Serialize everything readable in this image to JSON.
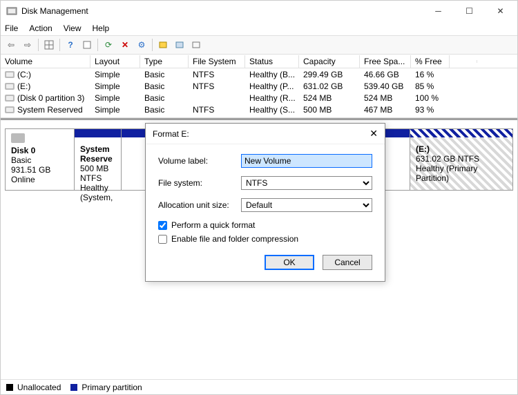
{
  "window": {
    "title": "Disk Management"
  },
  "menu": {
    "file": "File",
    "action": "Action",
    "view": "View",
    "help": "Help"
  },
  "columns": {
    "volume": "Volume",
    "layout": "Layout",
    "type": "Type",
    "fs": "File System",
    "status": "Status",
    "capacity": "Capacity",
    "free": "Free Spa...",
    "pct": "% Free"
  },
  "volumes": [
    {
      "name": "(C:)",
      "layout": "Simple",
      "type": "Basic",
      "fs": "NTFS",
      "status": "Healthy (B...",
      "capacity": "299.49 GB",
      "free": "46.66 GB",
      "pct": "16 %"
    },
    {
      "name": "(E:)",
      "layout": "Simple",
      "type": "Basic",
      "fs": "NTFS",
      "status": "Healthy (P...",
      "capacity": "631.02 GB",
      "free": "539.40 GB",
      "pct": "85 %"
    },
    {
      "name": "(Disk 0 partition 3)",
      "layout": "Simple",
      "type": "Basic",
      "fs": "",
      "status": "Healthy (R...",
      "capacity": "524 MB",
      "free": "524 MB",
      "pct": "100 %"
    },
    {
      "name": "System Reserved",
      "layout": "Simple",
      "type": "Basic",
      "fs": "NTFS",
      "status": "Healthy (S...",
      "capacity": "500 MB",
      "free": "467 MB",
      "pct": "93 %"
    }
  ],
  "disk": {
    "label": "Disk 0",
    "type": "Basic",
    "size": "931.51 GB",
    "state": "Online",
    "parts": [
      {
        "title": "System Reserve",
        "line2": "500 MB NTFS",
        "line3": "Healthy (System,",
        "width": 68
      },
      {
        "title": "(E:)",
        "line2": "631.02 GB NTFS",
        "line3": "Healthy (Primary Partition)",
        "width": 148,
        "selected": true
      }
    ]
  },
  "legend": {
    "unalloc": "Unallocated",
    "primary": "Primary partition"
  },
  "dialog": {
    "title": "Format E:",
    "volume_label_lbl": "Volume label:",
    "volume_label_val": "New Volume",
    "fs_lbl": "File system:",
    "fs_val": "NTFS",
    "aus_lbl": "Allocation unit size:",
    "aus_val": "Default",
    "quick": "Perform a quick format",
    "compress": "Enable file and folder compression",
    "ok": "OK",
    "cancel": "Cancel"
  }
}
